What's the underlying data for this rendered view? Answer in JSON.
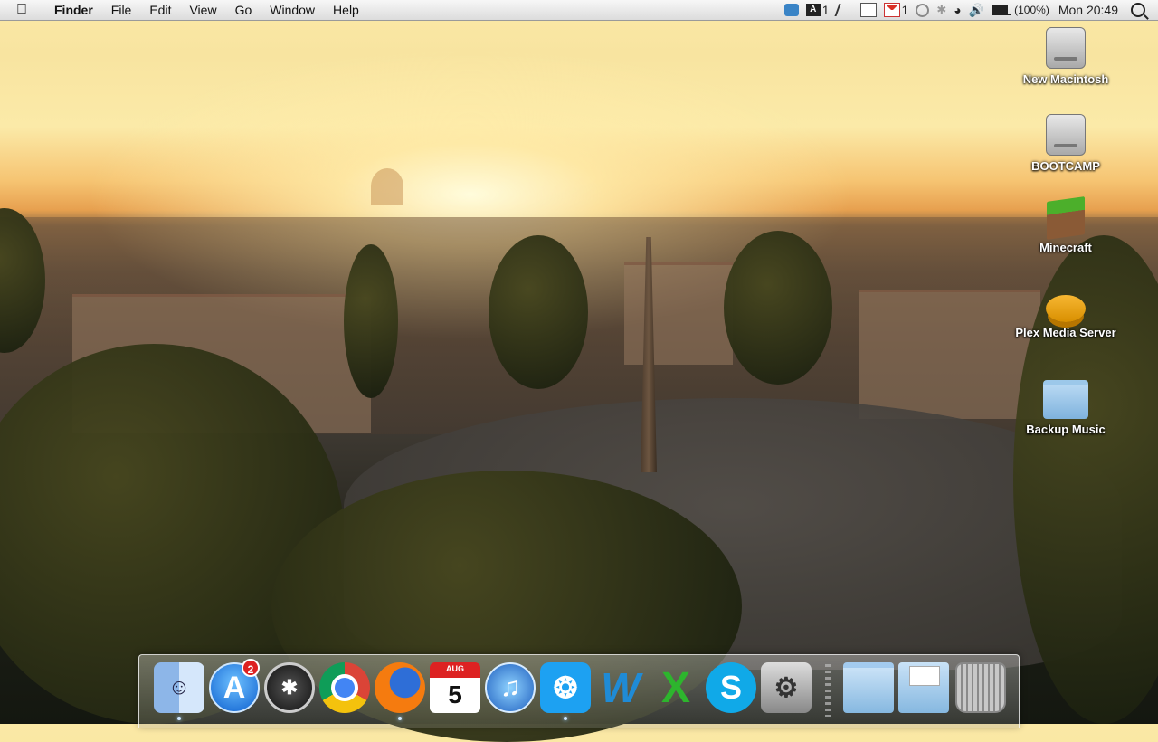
{
  "menubar": {
    "app_name": "Finder",
    "menus": [
      "File",
      "Edit",
      "View",
      "Go",
      "Window",
      "Help"
    ],
    "status": {
      "adobe_count": "1",
      "gmail_count": "1",
      "battery": "(100%)",
      "clock": "Mon 20:49"
    }
  },
  "desktop": {
    "icons": [
      {
        "label": "New Macintosh",
        "icon": "hard-drive-icon"
      },
      {
        "label": "BOOTCAMP",
        "icon": "hard-drive-icon"
      },
      {
        "label": "Minecraft",
        "icon": "minecraft-icon"
      },
      {
        "label": "Plex Media Server",
        "icon": "plex-icon"
      },
      {
        "label": "Backup Music",
        "icon": "folder-icon"
      }
    ]
  },
  "dock": {
    "items": [
      {
        "name": "finder",
        "running": true
      },
      {
        "name": "app-store",
        "badge": "2",
        "running": false
      },
      {
        "name": "dashboard",
        "running": false
      },
      {
        "name": "chrome",
        "running": false
      },
      {
        "name": "firefox",
        "running": true
      },
      {
        "name": "calendar",
        "month": "AUG",
        "day": "5",
        "running": false
      },
      {
        "name": "itunes",
        "running": false
      },
      {
        "name": "twitter",
        "running": true
      },
      {
        "name": "word",
        "running": false
      },
      {
        "name": "excel",
        "running": false
      },
      {
        "name": "skype",
        "running": false
      },
      {
        "name": "system-preferences",
        "running": false
      },
      {
        "name": "applications-folder",
        "running": false
      },
      {
        "name": "documents-folder",
        "running": false
      },
      {
        "name": "trash",
        "running": false
      }
    ]
  }
}
